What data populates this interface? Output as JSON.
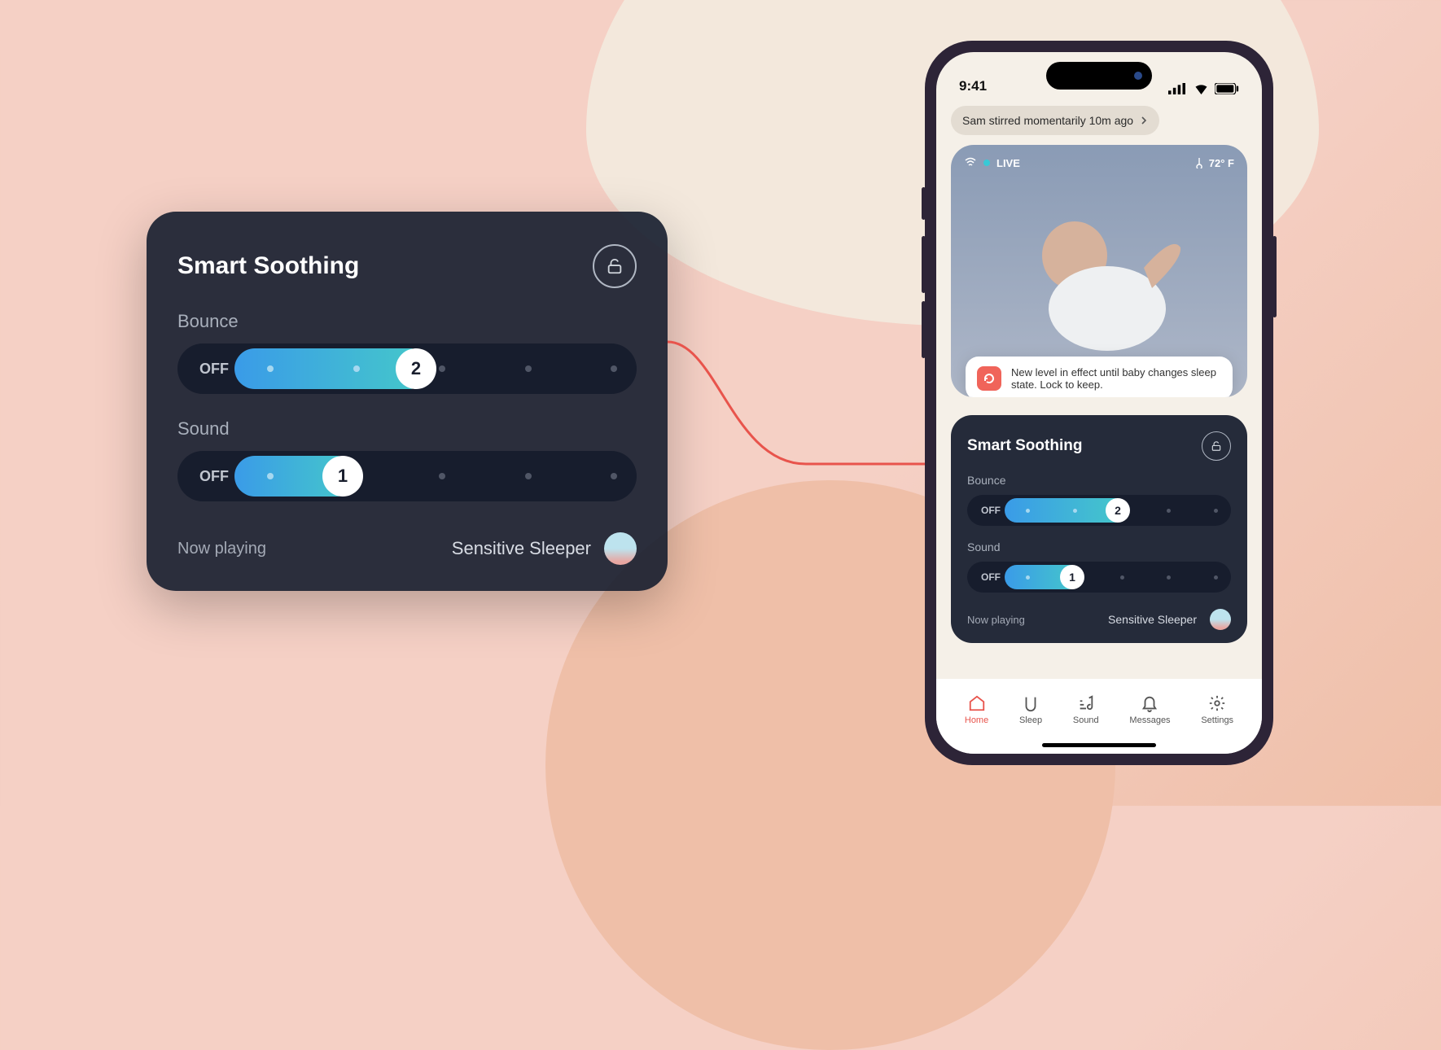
{
  "colors": {
    "accent_active": "#e8544c",
    "slider_gradient_from": "#3a9be8",
    "slider_gradient_to": "#45c9c9"
  },
  "big_panel": {
    "title": "Smart Soothing",
    "bounce": {
      "label": "Bounce",
      "off_label": "OFF",
      "value": "2"
    },
    "sound": {
      "label": "Sound",
      "off_label": "OFF",
      "value": "1"
    },
    "now_playing_label": "Now playing",
    "now_playing_track": "Sensitive Sleeper"
  },
  "phone": {
    "status": {
      "time": "9:41"
    },
    "alert_chip": "Sam stirred momentarily 10m ago",
    "video": {
      "live_label": "LIVE",
      "temperature": "72° F"
    },
    "toast": "New level in effect until baby changes sleep state. Lock to keep.",
    "panel": {
      "title": "Smart Soothing",
      "bounce": {
        "label": "Bounce",
        "off_label": "OFF",
        "value": "2"
      },
      "sound": {
        "label": "Sound",
        "off_label": "OFF",
        "value": "1"
      },
      "now_playing_label": "Now playing",
      "now_playing_track": "Sensitive Sleeper"
    },
    "tabs": {
      "home": "Home",
      "sleep": "Sleep",
      "sound": "Sound",
      "messages": "Messages",
      "settings": "Settings",
      "active": "home"
    }
  }
}
